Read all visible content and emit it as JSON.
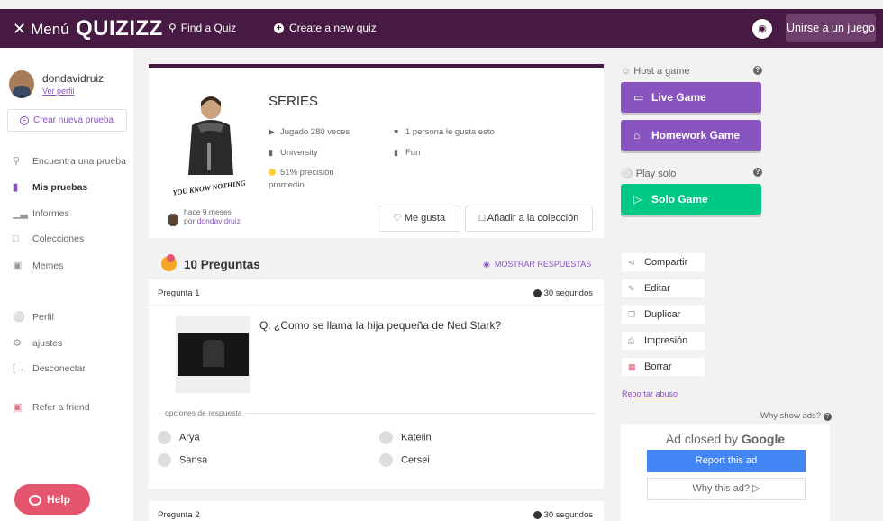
{
  "topbar": {
    "menu_label": "Menú",
    "logo": "QUIZIZZ",
    "find_quiz": "Find a Quiz",
    "create_quiz": "Create a new quiz",
    "join_label": "Unirse a un juego"
  },
  "sidebar": {
    "username": "dondavidruiz",
    "view_profile": "Ver perfil",
    "create_new": "Crear nueva prueba",
    "items": [
      {
        "label": "Encuentra una prueba",
        "icon": "search-icon"
      },
      {
        "label": "Mis pruebas",
        "icon": "document-icon"
      },
      {
        "label": "Informes",
        "icon": "bar-chart-icon"
      },
      {
        "label": "Colecciones",
        "icon": "folder-icon"
      },
      {
        "label": "Memes",
        "icon": "image-icon"
      },
      {
        "label": "Perfil",
        "icon": "user-icon"
      },
      {
        "label": "ajustes",
        "icon": "gear-icon"
      },
      {
        "label": "Desconectar",
        "icon": "logout-icon"
      },
      {
        "label": "Refer a friend",
        "icon": "gift-icon"
      }
    ],
    "help_label": "Help"
  },
  "quiz": {
    "title": "SERIES",
    "plays": "Jugado 280 veces",
    "likes": "1 persona le gusta esto",
    "level": "University",
    "subject": "Fun",
    "accuracy_line1": "51% precisión",
    "accuracy_line2": "promedio",
    "image_caption": "YOU KNOW NOTHING",
    "created_ago": "hace 9 meses",
    "created_by_prefix": "por",
    "author": "dondavidruiz",
    "like_button": "Me gusta",
    "add_collection_button": "Añadir a la colección"
  },
  "questions_header": {
    "count_label": "10 Preguntas",
    "show_answers": "MOSTRAR RESPUESTAS"
  },
  "questions": [
    {
      "number_label": "Pregunta 1",
      "time": "30 segundos",
      "text": "Q. ¿Como se llama la hija pequeña de Ned Stark?",
      "options_label": "opciones de respuesta",
      "options": [
        "Arya",
        "Katelin",
        "Sansa",
        "Cersei"
      ]
    },
    {
      "number_label": "Pregunta 2",
      "time": "30 segundos"
    }
  ],
  "right_panel": {
    "host_title": "Host a game",
    "live_game": "Live Game",
    "homework_game": "Homework Game",
    "play_solo_title": "Play solo",
    "solo_game": "Solo Game",
    "actions": [
      {
        "label": "Compartir",
        "icon": "share-icon"
      },
      {
        "label": "Editar",
        "icon": "edit-icon"
      },
      {
        "label": "Duplicar",
        "icon": "copy-icon"
      },
      {
        "label": "Impresión",
        "icon": "print-icon"
      },
      {
        "label": "Borrar",
        "icon": "trash-icon"
      }
    ],
    "report_abuse": "Reportar abuso",
    "why_show_ads": "Why show ads?",
    "ad_closed_prefix": "Ad closed by",
    "ad_closed_brand": "Google",
    "report_ad": "Report this ad",
    "why_this_ad": "Why this ad?"
  },
  "colors": {
    "topbar": "#461a42",
    "purple": "#8854c0",
    "green": "#00c985",
    "help": "#e5566e",
    "google_blue": "#4285f4"
  }
}
